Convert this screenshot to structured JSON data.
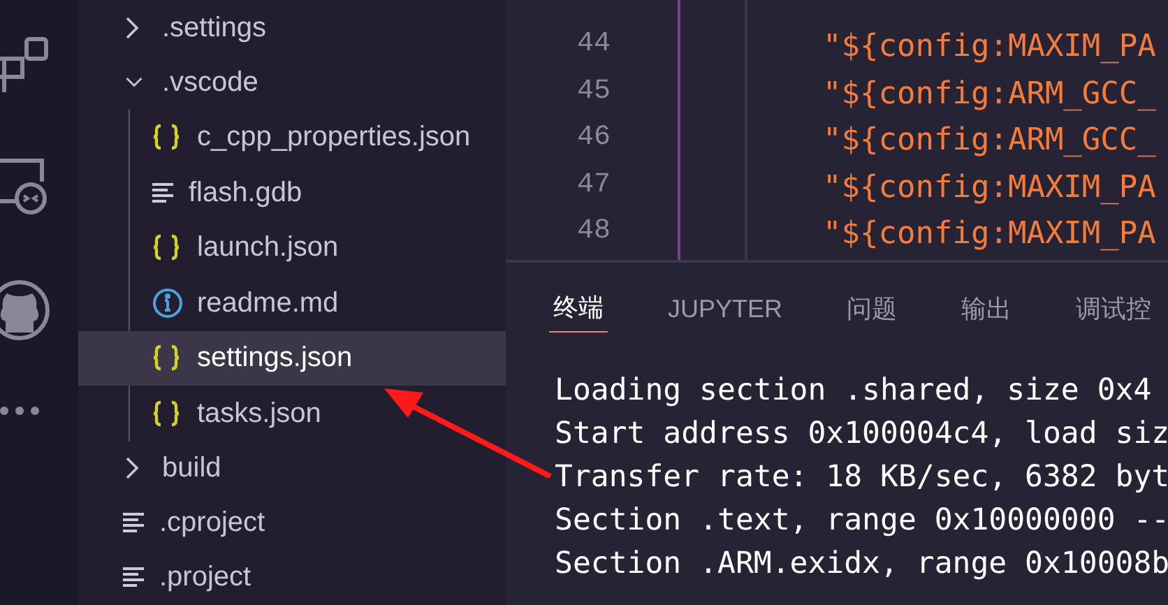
{
  "activity_bar": [
    {
      "kind": "extensions"
    },
    {
      "kind": "remote"
    },
    {
      "kind": "github"
    },
    {
      "kind": "more"
    }
  ],
  "explorer": {
    "items": [
      {
        "name": ".settings",
        "kind": "folder",
        "expanded": false,
        "selected": false
      },
      {
        "name": ".vscode",
        "kind": "folder",
        "expanded": true,
        "selected": false,
        "children": [
          {
            "name": "c_cpp_properties.json",
            "kind": "json",
            "selected": false
          },
          {
            "name": "flash.gdb",
            "kind": "text",
            "selected": false
          },
          {
            "name": "launch.json",
            "kind": "json",
            "selected": false
          },
          {
            "name": "readme.md",
            "kind": "info",
            "selected": false
          },
          {
            "name": "settings.json",
            "kind": "json",
            "selected": true
          },
          {
            "name": "tasks.json",
            "kind": "json",
            "selected": false
          }
        ]
      },
      {
        "name": "build",
        "kind": "folder",
        "expanded": false,
        "selected": false
      },
      {
        "name": ".cproject",
        "kind": "text",
        "selected": false
      },
      {
        "name": ".project",
        "kind": "text",
        "selected": false
      }
    ]
  },
  "editor": {
    "lines": [
      {
        "number": "44",
        "text": "\"${config:MAXIM_PA"
      },
      {
        "number": "45",
        "text": "\"${config:ARM_GCC_"
      },
      {
        "number": "46",
        "text": "\"${config:ARM_GCC_"
      },
      {
        "number": "47",
        "text": "\"${config:MAXIM_PA"
      },
      {
        "number": "48",
        "text": "\"${config:MAXIM_PA"
      }
    ]
  },
  "panel": {
    "tabs": [
      {
        "label": "终端",
        "selected": true
      },
      {
        "label": "JUPYTER",
        "selected": false
      },
      {
        "label": "问题",
        "selected": false
      },
      {
        "label": "输出",
        "selected": false
      },
      {
        "label": "调试控",
        "selected": false
      }
    ],
    "terminal_lines": [
      "Loading section .shared, size 0x4",
      "Start address 0x100004c4, load siz",
      "Transfer rate: 18 KB/sec, 6382 byt",
      "Section .text, range 0x10000000 --",
      "Section .ARM.exidx, range 0x10008b"
    ]
  }
}
